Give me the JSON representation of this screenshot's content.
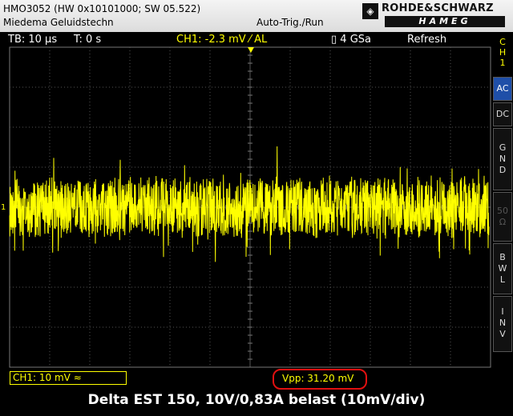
{
  "header": {
    "device": "HMO3052 (HW 0x10101000; SW 05.522)",
    "owner": "Miedema Geluidstechn",
    "trigger_mode": "Auto-Trig./Run",
    "brand_top": "ROHDE&SCHWARZ",
    "brand_bottom": "HAMEG"
  },
  "status": {
    "timebase": "TB: 10 µs",
    "trigger_time": "T: 0 s",
    "ch1_trigger": "CH1: -2.3 mV ⁄ AL",
    "sample_rate": "4 GSa",
    "acq_mode": "Refresh"
  },
  "side_menu": {
    "title": [
      "C",
      "H",
      "1"
    ],
    "ac": "AC",
    "dc": "DC",
    "gnd": [
      "G",
      "N",
      "D"
    ],
    "fifty": [
      "50",
      "Ω"
    ],
    "bwl": [
      "B",
      "W",
      "L"
    ],
    "inv": [
      "I",
      "N",
      "V"
    ]
  },
  "channel_marker": "1",
  "bottom": {
    "ch1_scale": "CH1: 10 mV ≈",
    "vpp": "Vpp: 31.20 mV"
  },
  "caption": "Delta EST 150, 10V/0,83A belast  (10mV/div)",
  "colors": {
    "trace": "#ffff00",
    "highlight": "#e01010",
    "active_button": "#1f4fa8"
  }
}
